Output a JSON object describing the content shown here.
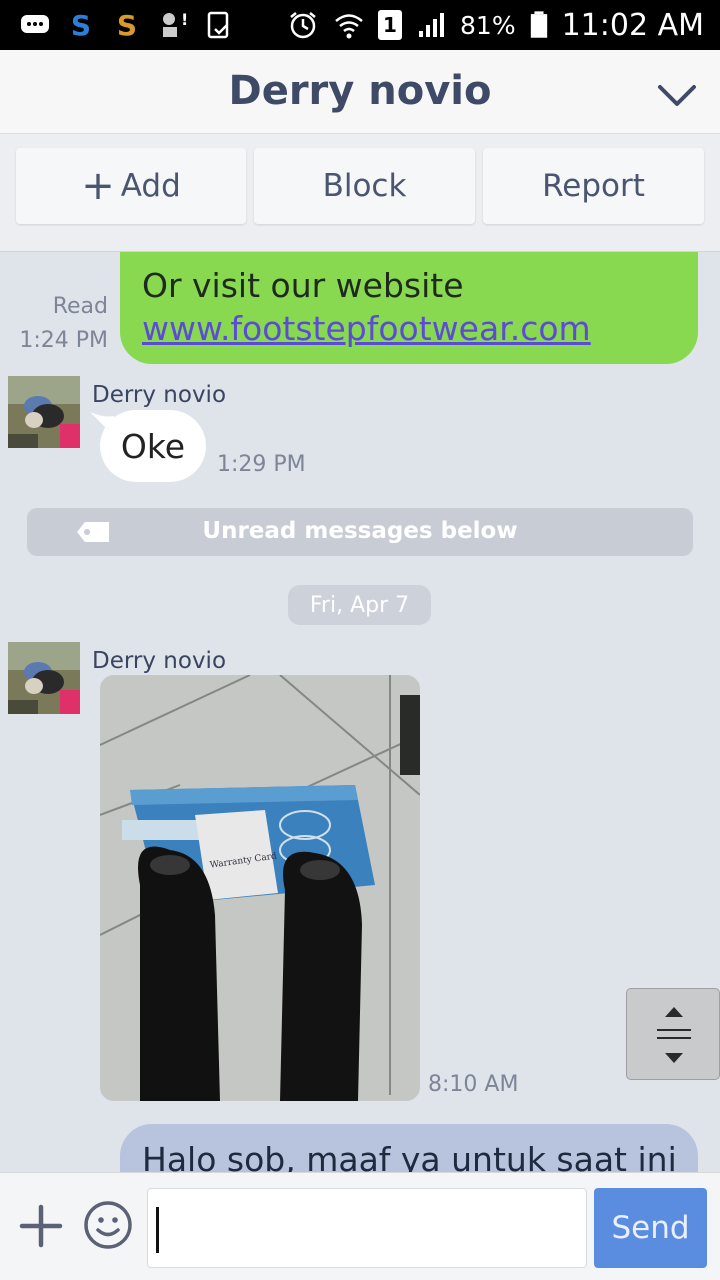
{
  "status_bar": {
    "battery": "81%",
    "time": "11:02 AM",
    "sim_slot": "1",
    "icons": [
      "messages-icon",
      "skype-icon",
      "skype-icon",
      "notification-icon",
      "clipboard-icon",
      "alarm-icon",
      "wifi-icon",
      "sim-icon",
      "signal-icon",
      "battery-icon"
    ]
  },
  "header": {
    "title": "Derry novio",
    "chevron_icon": "chevron-down-icon"
  },
  "actions": {
    "add_label": "Add",
    "block_label": "Block",
    "report_label": "Report"
  },
  "messages": {
    "outgoing_1": {
      "line1": "Or visit our website",
      "link": "www.footstepfootwear.com",
      "status": "Read",
      "time": "1:24 PM"
    },
    "incoming_1": {
      "sender": "Derry novio",
      "text": "Oke",
      "time": "1:29 PM"
    },
    "unread_banner": "Unread messages below",
    "date_divider": "Fri, Apr 7",
    "incoming_2": {
      "sender": "Derry novio",
      "photo_text": "Warranty Card",
      "time": "8:10 AM"
    },
    "outgoing_2": {
      "text": "Halo sob, maaf ya untuk saat ini"
    }
  },
  "input": {
    "value": "",
    "send_label": "Send"
  },
  "colors": {
    "outgoing_bubble": "#88d850",
    "outgoing_bubble_2": "#b8c3de",
    "send_button": "#5a8de0",
    "link": "#5b4cd6",
    "title_text": "#3e4a66"
  }
}
